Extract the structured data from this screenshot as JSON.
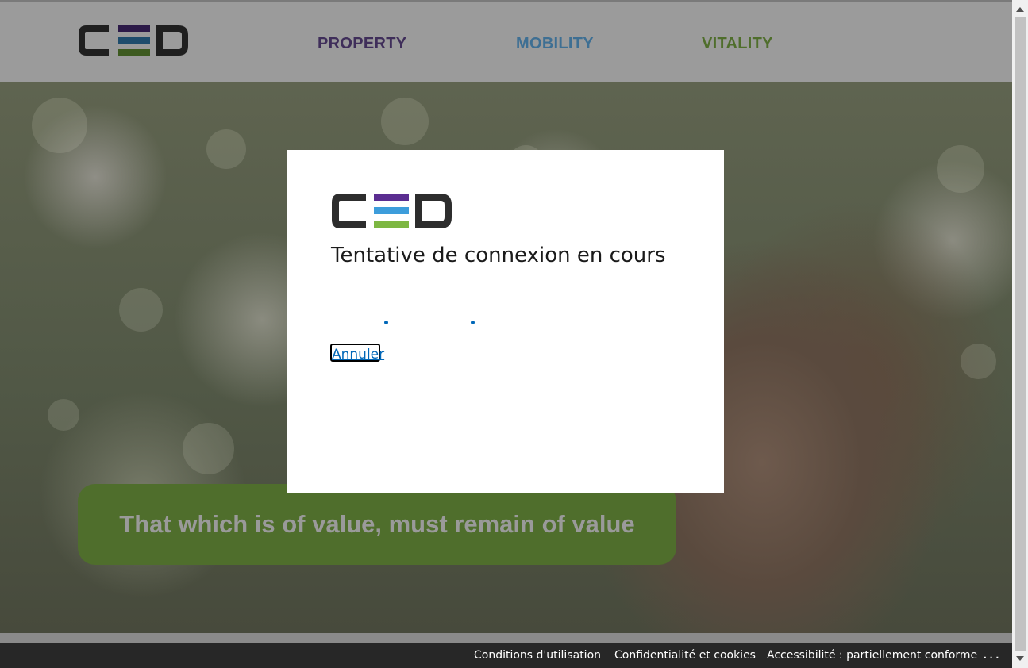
{
  "header": {
    "logo_text": "CED",
    "nav": [
      {
        "label": "PROPERTY",
        "color": "#3f2e5a"
      },
      {
        "label": "MOBILITY",
        "color": "#3e6f93"
      },
      {
        "label": "VITALITY",
        "color": "#4f6e2c"
      }
    ]
  },
  "hero": {
    "tagline": "That which is of value, must remain of value"
  },
  "modal": {
    "logo_text": "CED",
    "title": "Tentative de connexion en cours",
    "cancel_label": "Annuler"
  },
  "footer": {
    "links": [
      {
        "label": "Conditions d'utilisation"
      },
      {
        "label": "Confidentialité et cookies"
      },
      {
        "label": "Accessibilité : partiellement conforme"
      }
    ],
    "more_label": "..."
  },
  "colors": {
    "logo_dark": "#2d2d2d",
    "logo_purple": "#5b2e91",
    "logo_blue": "#3d9ddb",
    "logo_green": "#7db742",
    "link_blue": "#0067b8"
  }
}
